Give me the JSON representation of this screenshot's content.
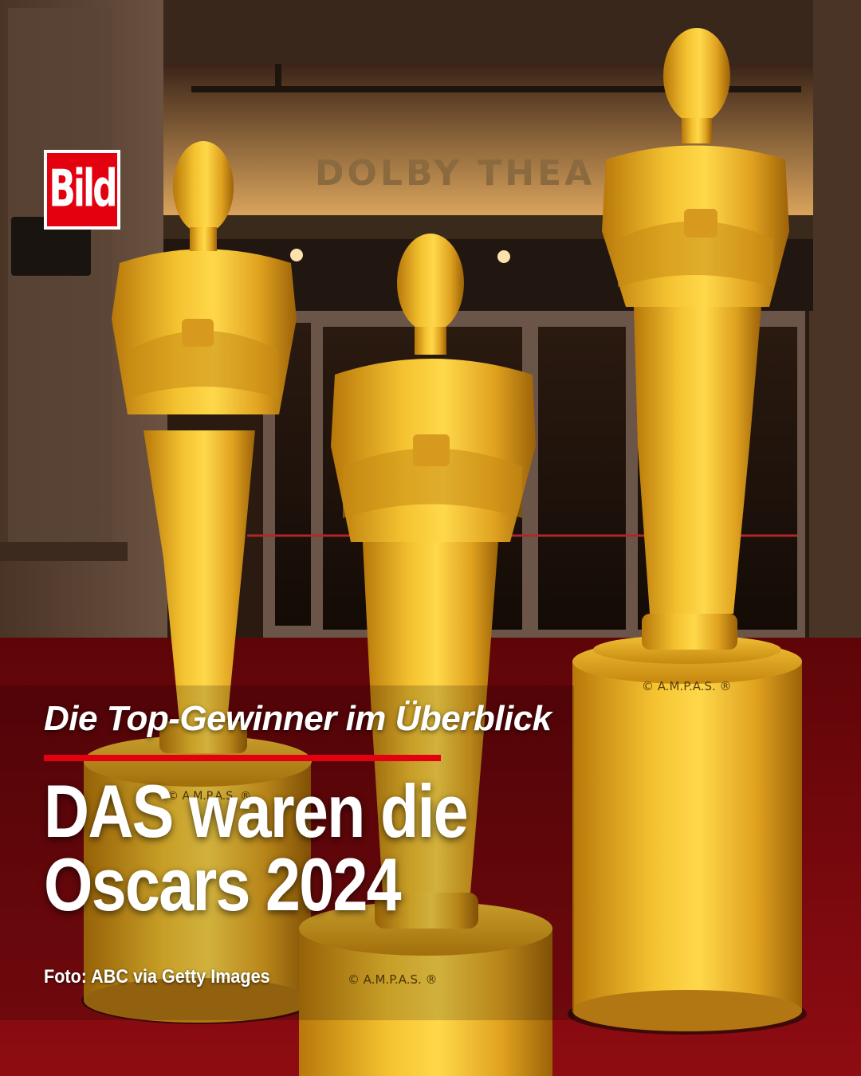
{
  "brand": {
    "logo_text": "Bild",
    "color": "#e3000f"
  },
  "venue_sign": "DOLBY THEA",
  "pedestal_marks": [
    "© A.M.P.A.S. ®",
    "© A.M.P.A.S. ®",
    "© A.M.P.A.S. ®"
  ],
  "kicker": "Die Top-Gewinner im Überblick",
  "headline": {
    "line1": "DAS waren die",
    "line2": "Oscars 2024"
  },
  "photo_credit": "Foto: ABC via Getty Images",
  "colors": {
    "gold": "#e0a21f",
    "carpet_red": "#8e0c12",
    "accent_red": "#e3000f",
    "text": "#ffffff"
  }
}
